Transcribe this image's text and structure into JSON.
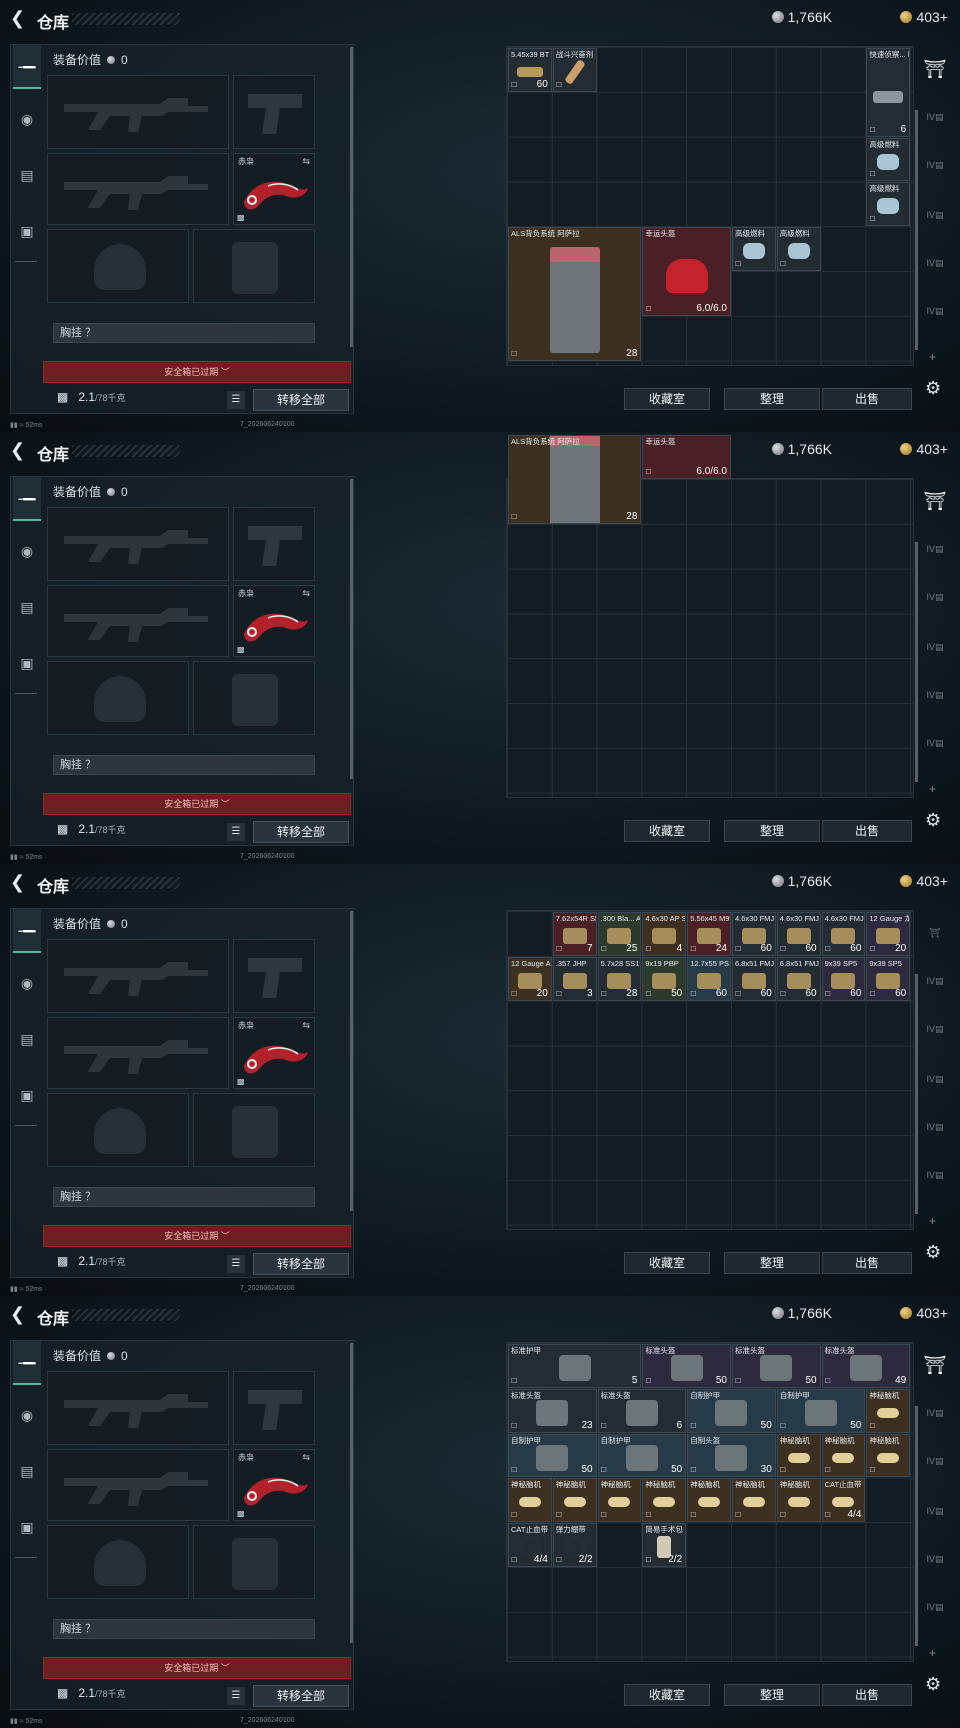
{
  "header": {
    "title": "仓库",
    "silver": "1,766K",
    "gold": "403+"
  },
  "equipment": {
    "value_label": "装备价值",
    "value": "0",
    "knife_label": "赤枭",
    "chest_label": "胸挂 ？",
    "safebox_label": "安全箱已过期 ﹀",
    "weight": "2.1",
    "weight_max": "/78千克",
    "transfer_all": "转移全部"
  },
  "stash_buttons": {
    "collection": "收藏室",
    "organize": "整理",
    "sell": "出售"
  },
  "status": {
    "ping": "52ms",
    "build": "7_202606240100"
  },
  "screens": [
    {
      "items": [
        {
          "name": "5.45x39 BT",
          "count": "60"
        },
        {
          "name": "战斗兴奋剂"
        },
        {
          "name": "快速侦察... 哈夫克",
          "count": "6"
        },
        {
          "name": "高级燃料"
        },
        {
          "name": "高级燃料"
        },
        {
          "name": "ALS背负系统 阿萨拉",
          "count": "28"
        },
        {
          "name": "幸运头盔",
          "count": "6.0/6.0"
        },
        {
          "name": "高级燃料"
        },
        {
          "name": "高级燃料"
        }
      ]
    },
    {
      "items": [
        {
          "name": "ALS背负系统 阿萨拉",
          "count": "28"
        },
        {
          "name": "幸运头盔",
          "count": "6.0/6.0"
        }
      ]
    },
    {
      "items": [
        {
          "name": "7.62x54R SNB",
          "count": "7"
        },
        {
          "name": ".300 Bla... AP",
          "count": "25"
        },
        {
          "name": "4.6x30 AP SX",
          "count": "4"
        },
        {
          "name": "5.56x45 M995",
          "count": "24"
        },
        {
          "name": "4.6x30 FMJ SX",
          "count": "60"
        },
        {
          "name": "4.6x30 FMJ SX",
          "count": "60"
        },
        {
          "name": "4.6x30 FMJ SX",
          "count": "60"
        },
        {
          "name": "12 Gauge 龙息弹",
          "count": "20"
        },
        {
          "name": "12 Gauge AP-20",
          "count": "20"
        },
        {
          "name": ".357 JHP",
          "count": "3"
        },
        {
          "name": "5.7x28 SS190",
          "count": "28"
        },
        {
          "name": "9x19 PBP",
          "count": "50"
        },
        {
          "name": "12.7x55 PS12B",
          "count": "60"
        },
        {
          "name": "6.8x51 FMJ",
          "count": "60"
        },
        {
          "name": "6.8x51 FMJ",
          "count": "60"
        },
        {
          "name": "9x39 SP5",
          "count": "60"
        },
        {
          "name": "9x39 SP5",
          "count": "60"
        }
      ]
    },
    {
      "items": [
        {
          "name": "标准护甲",
          "count": "5"
        },
        {
          "name": "标准头盔",
          "count": "50"
        },
        {
          "name": "标准头盔",
          "count": "50"
        },
        {
          "name": "标准头盔",
          "count": "49"
        },
        {
          "name": "标准头盔",
          "count": "23"
        },
        {
          "name": "标准头盔",
          "count": "6"
        },
        {
          "name": "自制护甲",
          "count": "50"
        },
        {
          "name": "自制护甲",
          "count": "50"
        },
        {
          "name": "神秘脑机"
        },
        {
          "name": "自制护甲",
          "count": "50"
        },
        {
          "name": "自制护甲",
          "count": "50"
        },
        {
          "name": "自制头盔",
          "count": "30"
        },
        {
          "name": "神秘脑机"
        },
        {
          "name": "神秘脑机"
        },
        {
          "name": "神秘脑机"
        },
        {
          "name": "神秘脑机"
        },
        {
          "name": "神秘脑机"
        },
        {
          "name": "神秘脑机"
        },
        {
          "name": "神秘脑机"
        },
        {
          "name": "神秘脑机"
        },
        {
          "name": "神秘脑机"
        },
        {
          "name": "神秘脑机"
        },
        {
          "name": "CAT止血带",
          "count": "4/4"
        },
        {
          "name": "CAT止血带",
          "count": "4/4"
        },
        {
          "name": "弹力绷带",
          "count": "2/2"
        },
        {
          "name": "简易手术包",
          "count": "2/2"
        }
      ]
    }
  ],
  "icons": [
    "back-arrow-icon",
    "silver-coin-icon",
    "gold-coin-icon",
    "pistol-icon",
    "helmet-icon",
    "armor-icon",
    "backpack-icon",
    "lock-icon",
    "list-icon",
    "stash-icon",
    "gear-icon",
    "swap-icon"
  ]
}
